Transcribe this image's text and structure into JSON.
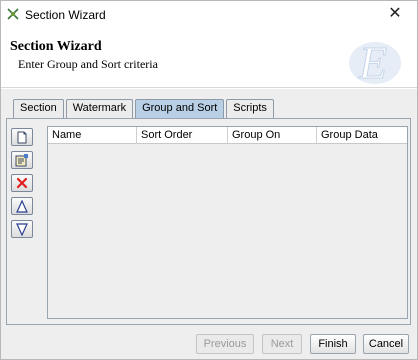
{
  "window": {
    "title": "Section Wizard",
    "close_glyph": "✕"
  },
  "banner": {
    "title": "Section Wizard",
    "subtitle": "Enter Group and Sort criteria",
    "logo_letter": "E"
  },
  "tabs": [
    {
      "label": "Section",
      "active": false
    },
    {
      "label": "Watermark",
      "active": false
    },
    {
      "label": "Group and Sort",
      "active": true
    },
    {
      "label": "Scripts",
      "active": false
    }
  ],
  "toolbar": [
    {
      "name": "new-icon"
    },
    {
      "name": "properties-icon"
    },
    {
      "name": "delete-icon"
    },
    {
      "name": "move-up-icon"
    },
    {
      "name": "move-down-icon"
    }
  ],
  "table": {
    "columns": [
      "Name",
      "Sort Order",
      "Group On",
      "Group Data"
    ],
    "rows": []
  },
  "buttons": {
    "previous": "Previous",
    "next": "Next",
    "finish": "Finish",
    "cancel": "Cancel"
  },
  "colors": {
    "active_tab": "#b8cfe5",
    "delete_red": "#e02020",
    "arrow_blue": "#2a3f8f"
  }
}
